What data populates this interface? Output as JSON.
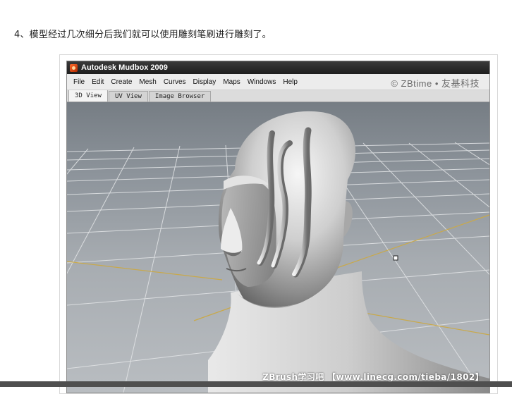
{
  "caption": "4、模型经过几次细分后我们就可以使用雕刻笔刷进行雕刻了。",
  "window": {
    "title": "Autodesk Mudbox 2009"
  },
  "menu": {
    "items": [
      "File",
      "Edit",
      "Create",
      "Mesh",
      "Curves",
      "Display",
      "Maps",
      "Windows",
      "Help"
    ]
  },
  "watermark_top": "© ZBtime • 友基科技",
  "tabs": [
    {
      "label": "3D View",
      "active": true
    },
    {
      "label": "UV View",
      "active": false
    },
    {
      "label": "Image Browser",
      "active": false
    }
  ],
  "watermark_bottom": "ZBrush学习吧 【www.linecg.com/tieba/1802】",
  "colors": {
    "viewport_top": "#767d84",
    "viewport_bottom": "#b9bdc1",
    "grid_line": "#e4e6e8",
    "axis_line": "#c9a94a"
  }
}
